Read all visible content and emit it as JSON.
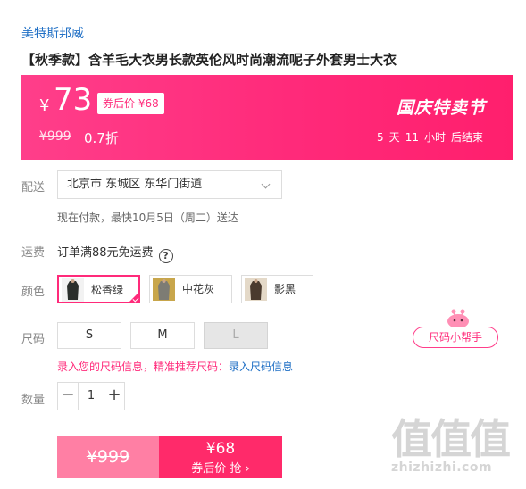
{
  "product": {
    "brand": "美特斯邦威",
    "title": "【秋季款】含羊毛大衣男长款英伦风时尚潮流呢子外套男士大衣"
  },
  "promo": {
    "currency": "¥",
    "price": "73",
    "coupon_price_label": "券后价 ¥68",
    "original_price": "¥999",
    "discount": "0.7折",
    "event_name": "国庆特卖节",
    "countdown": {
      "days": "5",
      "days_unit": "天",
      "hours": "11",
      "hours_unit": "小时",
      "suffix": "后结束"
    },
    "colors": {
      "gradient_start": "#ff3e8a",
      "gradient_end": "#ff1f6d"
    }
  },
  "delivery": {
    "label": "配送",
    "address": "北京市 东城区 东华门街道",
    "note": "现在付款，最快10月5日（周二）送达"
  },
  "freight": {
    "label": "运费",
    "text": "订单满88元免运费",
    "help_icon": "question-circle-icon"
  },
  "color_select": {
    "label": "颜色",
    "options": [
      {
        "name": "松香绿",
        "selected": true
      },
      {
        "name": "中花灰",
        "selected": false
      },
      {
        "name": "影黑",
        "selected": false
      }
    ]
  },
  "size_select": {
    "label": "尺码",
    "options": [
      {
        "name": "S",
        "disabled": false
      },
      {
        "name": "M",
        "disabled": false
      },
      {
        "name": "L",
        "disabled": true
      }
    ],
    "helper_label": "尺码小帮手",
    "hint_text": "录入您的尺码信息，精准推荐尺码：",
    "hint_link": "录入尺码信息"
  },
  "quantity": {
    "label": "数量",
    "value": "1",
    "minus": "−",
    "plus": "+"
  },
  "cta": {
    "original_price": "¥999",
    "coupon_price": "¥68",
    "coupon_action": "券后价 抢 ›"
  },
  "watermark": {
    "glyphs": "值值值",
    "domain": "zhizhizhi.com"
  },
  "accent_color": "#ff2a7a",
  "link_color": "#1f6fc5"
}
